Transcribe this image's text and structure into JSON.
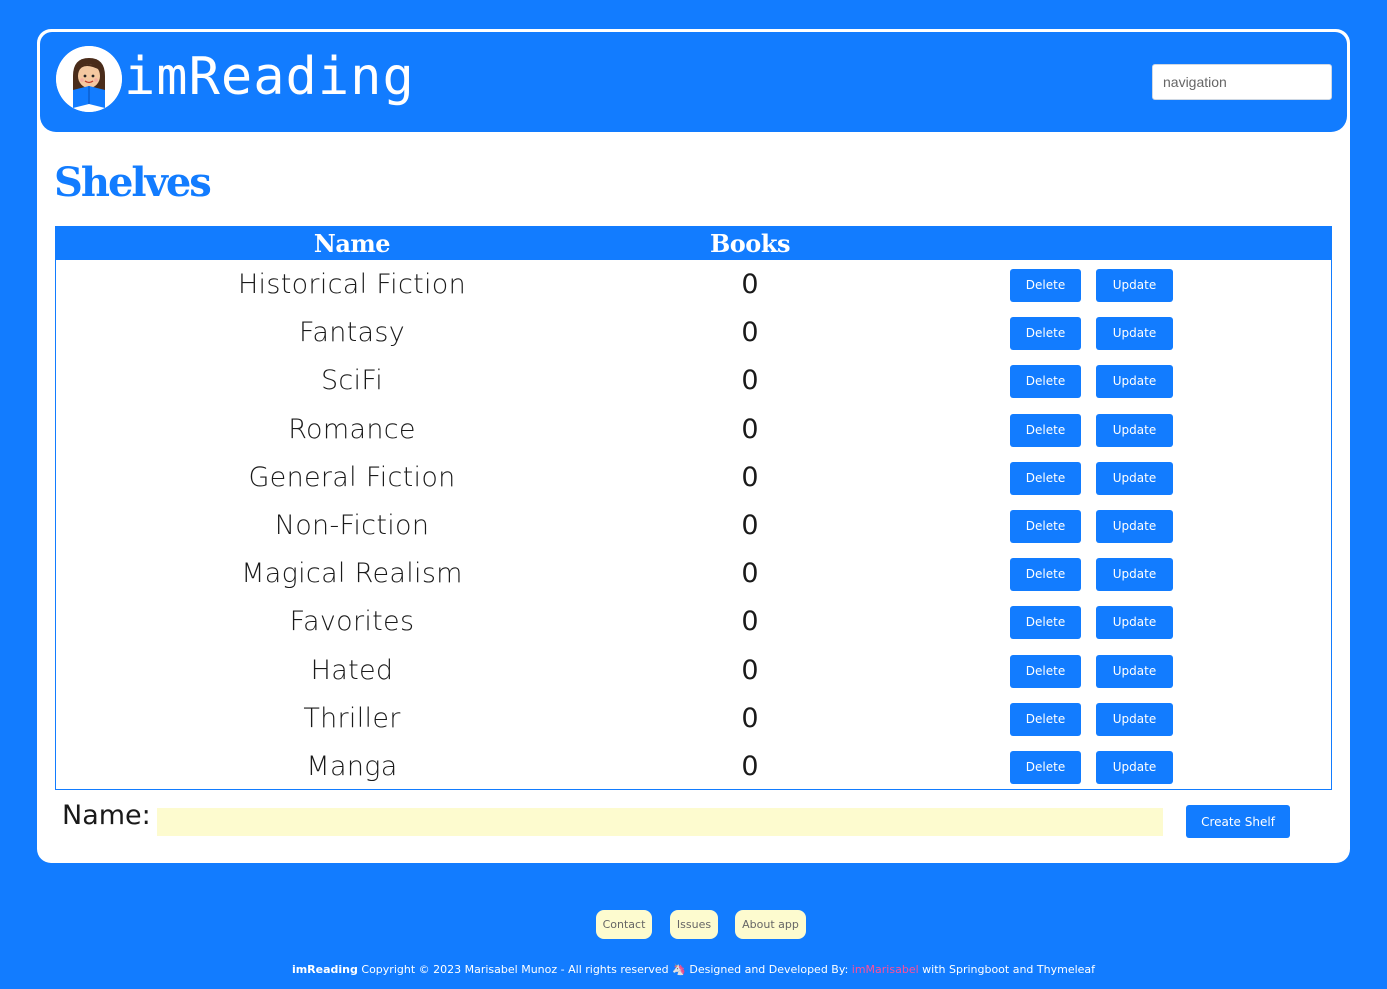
{
  "header": {
    "brand": "imReading",
    "nav_placeholder": "navigation"
  },
  "page": {
    "title": "Shelves"
  },
  "table": {
    "columns": [
      "Name",
      "Books"
    ],
    "rows": [
      {
        "name": "Historical Fiction",
        "books": "0"
      },
      {
        "name": "Fantasy",
        "books": "0"
      },
      {
        "name": "SciFi",
        "books": "0"
      },
      {
        "name": "Romance",
        "books": "0"
      },
      {
        "name": "General Fiction",
        "books": "0"
      },
      {
        "name": "Non-Fiction",
        "books": "0"
      },
      {
        "name": "Magical Realism",
        "books": "0"
      },
      {
        "name": "Favorites",
        "books": "0"
      },
      {
        "name": "Hated",
        "books": "0"
      },
      {
        "name": "Thriller",
        "books": "0"
      },
      {
        "name": "Manga",
        "books": "0"
      }
    ],
    "delete_label": "Delete",
    "update_label": "Update"
  },
  "form": {
    "label": "Name:",
    "value": "",
    "submit_label": "Create Shelf"
  },
  "footer": {
    "links": [
      "Contact",
      "Issues",
      "About app"
    ],
    "brand": "imReading",
    "copyright": "Copyright © 2023 Marisabel Munoz - All rights reserved",
    "unicorn": "🦄",
    "designed_by": "Designed and Developed By:",
    "author": "imMarisabel",
    "with": "with Springboot and Thymeleaf"
  },
  "colors": {
    "primary": "#127cff",
    "background": "#127cff",
    "input_fill": "#fdfbcf",
    "author_link": "#ff4f9a"
  }
}
